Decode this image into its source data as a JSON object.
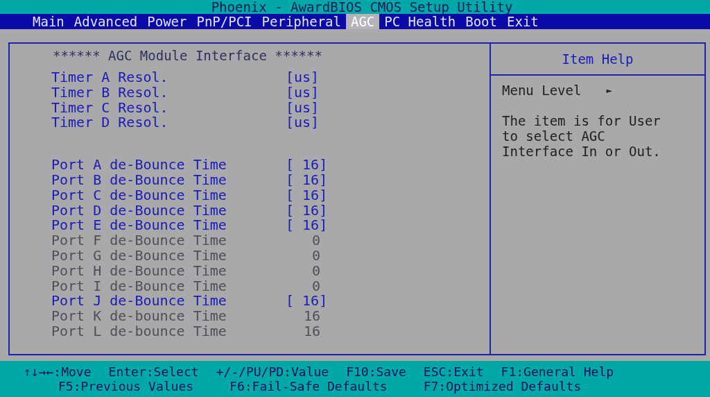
{
  "window": {
    "title": "Phoenix - AwardBIOS CMOS Setup Utility"
  },
  "tabs": [
    {
      "label": "Main",
      "selected": false
    },
    {
      "label": "Advanced",
      "selected": false
    },
    {
      "label": "Power",
      "selected": false
    },
    {
      "label": "PnP/PCI",
      "selected": false
    },
    {
      "label": "Peripheral",
      "selected": false
    },
    {
      "label": "AGC",
      "selected": true
    },
    {
      "label": "PC Health",
      "selected": false
    },
    {
      "label": "Boot",
      "selected": false
    },
    {
      "label": "Exit",
      "selected": false
    }
  ],
  "panel": {
    "heading": "****** AGC Module Interface ******",
    "groups": [
      [
        {
          "label": "Timer A Resol.",
          "value": "[us]",
          "disabled": false
        },
        {
          "label": "Timer B Resol.",
          "value": "[us]",
          "disabled": false
        },
        {
          "label": "Timer C Resol.",
          "value": "[us]",
          "disabled": false
        },
        {
          "label": "Timer D Resol.",
          "value": "[us]",
          "disabled": false
        }
      ],
      [
        {
          "label": "Port A de-Bounce Time",
          "value": "[ 16]",
          "disabled": false
        },
        {
          "label": "Port B de-Bounce Time",
          "value": "[ 16]",
          "disabled": false
        },
        {
          "label": "Port C de-Bounce Time",
          "value": "[ 16]",
          "disabled": false
        },
        {
          "label": "Port D de-Bounce Time",
          "value": "[ 16]",
          "disabled": false
        },
        {
          "label": "Port E de-Bounce Time",
          "value": "[ 16]",
          "disabled": false
        },
        {
          "label": "Port F de-Bounce Time",
          "value": "0",
          "disabled": true
        },
        {
          "label": "Port G de-Bounce Time",
          "value": "0",
          "disabled": true
        },
        {
          "label": "Port H de-Bounce Time",
          "value": "0",
          "disabled": true
        },
        {
          "label": "Port I de-Bounce Time",
          "value": "0",
          "disabled": true
        },
        {
          "label": "Port J de-Bounce Time",
          "value": "[ 16]",
          "disabled": false
        },
        {
          "label": "Port K de-bounce Time",
          "value": "16",
          "disabled": true
        },
        {
          "label": "Port L de-bounce Time",
          "value": "16",
          "disabled": true
        }
      ]
    ]
  },
  "help": {
    "title": "Item Help",
    "menu_level": "Menu Level",
    "menu_level_marker": "►",
    "text": "The item is for User to select AGC Interface In or Out."
  },
  "footer": [
    [
      "↑↓→←:Move",
      "Enter:Select",
      "+/-/PU/PD:Value",
      "F10:Save",
      "ESC:Exit",
      "F1:General Help"
    ],
    [
      "F5:Previous Values",
      "F6:Fail-Safe Defaults",
      "F7:Optimized Defaults"
    ]
  ]
}
